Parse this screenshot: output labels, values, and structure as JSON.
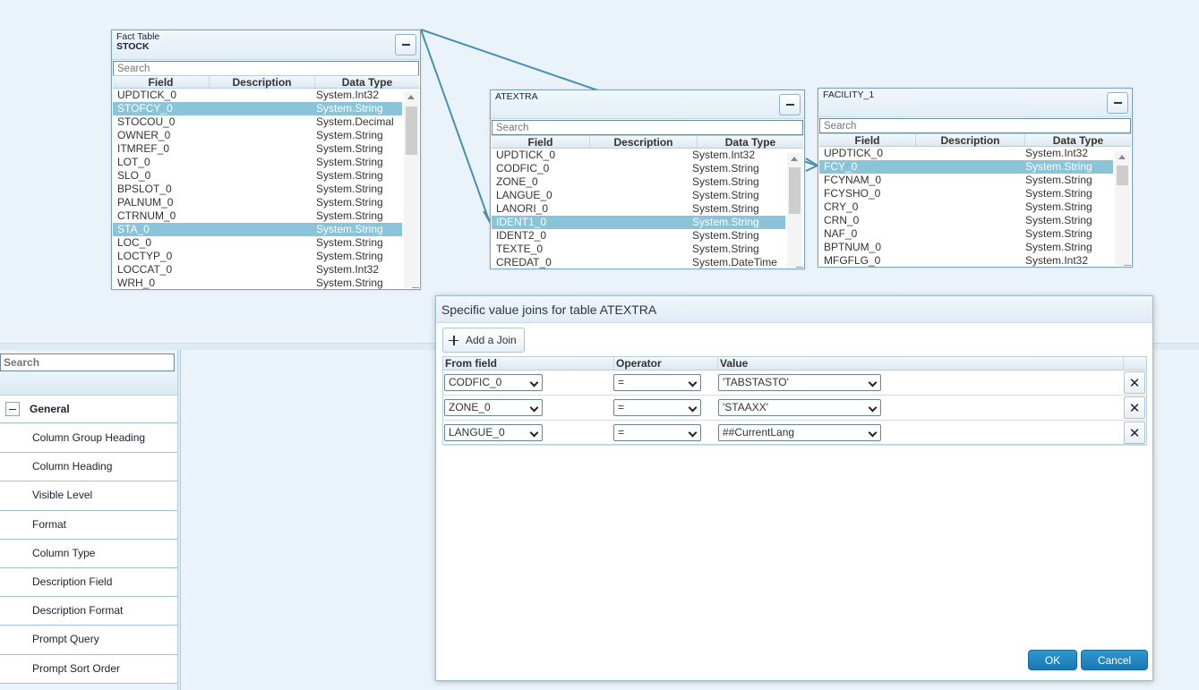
{
  "canvas": {
    "tables": [
      {
        "id": "stock",
        "title": "Fact Table",
        "subtitle": "STOCK",
        "search_placeholder": "Search",
        "columns": [
          "Field",
          "Description",
          "Data Type"
        ],
        "rows": [
          {
            "field": "UPDTICK_0",
            "description": "",
            "type": "System.Int32",
            "selected": false
          },
          {
            "field": "STOFCY_0",
            "description": "",
            "type": "System.String",
            "selected": true
          },
          {
            "field": "STOCOU_0",
            "description": "",
            "type": "System.Decimal",
            "selected": false
          },
          {
            "field": "OWNER_0",
            "description": "",
            "type": "System.String",
            "selected": false
          },
          {
            "field": "ITMREF_0",
            "description": "",
            "type": "System.String",
            "selected": false
          },
          {
            "field": "LOT_0",
            "description": "",
            "type": "System.String",
            "selected": false
          },
          {
            "field": "SLO_0",
            "description": "",
            "type": "System.String",
            "selected": false
          },
          {
            "field": "BPSLOT_0",
            "description": "",
            "type": "System.String",
            "selected": false
          },
          {
            "field": "PALNUM_0",
            "description": "",
            "type": "System.String",
            "selected": false
          },
          {
            "field": "CTRNUM_0",
            "description": "",
            "type": "System.String",
            "selected": false
          },
          {
            "field": "STA_0",
            "description": "",
            "type": "System.String",
            "selected": true
          },
          {
            "field": "LOC_0",
            "description": "",
            "type": "System.String",
            "selected": false
          },
          {
            "field": "LOCTYP_0",
            "description": "",
            "type": "System.String",
            "selected": false
          },
          {
            "field": "LOCCAT_0",
            "description": "",
            "type": "System.Int32",
            "selected": false
          },
          {
            "field": "WRH_0",
            "description": "",
            "type": "System.String",
            "selected": false
          }
        ]
      },
      {
        "id": "atextra",
        "title": "ATEXTRA",
        "subtitle": "",
        "search_placeholder": "Search",
        "columns": [
          "Field",
          "Description",
          "Data Type"
        ],
        "rows": [
          {
            "field": "UPDTICK_0",
            "description": "",
            "type": "System.Int32",
            "selected": false
          },
          {
            "field": "CODFIC_0",
            "description": "",
            "type": "System.String",
            "selected": false
          },
          {
            "field": "ZONE_0",
            "description": "",
            "type": "System.String",
            "selected": false
          },
          {
            "field": "LANGUE_0",
            "description": "",
            "type": "System.String",
            "selected": false
          },
          {
            "field": "LANORI_0",
            "description": "",
            "type": "System.String",
            "selected": false
          },
          {
            "field": "IDENT1_0",
            "description": "",
            "type": "System.String",
            "selected": true
          },
          {
            "field": "IDENT2_0",
            "description": "",
            "type": "System.String",
            "selected": false
          },
          {
            "field": "TEXTE_0",
            "description": "",
            "type": "System.String",
            "selected": false
          },
          {
            "field": "CREDAT_0",
            "description": "",
            "type": "System.DateTime",
            "selected": false
          }
        ]
      },
      {
        "id": "facility",
        "title": "FACILITY_1",
        "subtitle": "",
        "search_placeholder": "Search",
        "columns": [
          "Field",
          "Description",
          "Data Type"
        ],
        "rows": [
          {
            "field": "UPDTICK_0",
            "description": "",
            "type": "System.Int32",
            "selected": false
          },
          {
            "field": "FCY_0",
            "description": "",
            "type": "System.String",
            "selected": true
          },
          {
            "field": "FCYNAM_0",
            "description": "",
            "type": "System.String",
            "selected": false
          },
          {
            "field": "FCYSHO_0",
            "description": "",
            "type": "System.String",
            "selected": false
          },
          {
            "field": "CRY_0",
            "description": "",
            "type": "System.String",
            "selected": false
          },
          {
            "field": "CRN_0",
            "description": "",
            "type": "System.String",
            "selected": false
          },
          {
            "field": "NAF_0",
            "description": "",
            "type": "System.String",
            "selected": false
          },
          {
            "field": "BPTNUM_0",
            "description": "",
            "type": "System.String",
            "selected": false
          },
          {
            "field": "MFGFLG_0",
            "description": "",
            "type": "System.Int32",
            "selected": false
          }
        ]
      }
    ]
  },
  "properties_panel": {
    "search_placeholder": "Search",
    "group_label": "General",
    "items": [
      "Column Group Heading",
      "Column Heading",
      "Visible Level",
      "Format",
      "Column Type",
      "Description Field",
      "Description Format",
      "Prompt Query",
      "Prompt Sort Order"
    ]
  },
  "join_dialog": {
    "title": "Specific value joins for table ATEXTRA",
    "add_button_label": "Add a Join",
    "columns": [
      "From field",
      "Operator",
      "Value"
    ],
    "rows": [
      {
        "from_field": "CODFIC_0",
        "operator": "=",
        "value": "'TABSTASTO'"
      },
      {
        "from_field": "ZONE_0",
        "operator": "=",
        "value": "'STAAXX'"
      },
      {
        "from_field": "LANGUE_0",
        "operator": "=",
        "value": "##CurrentLang"
      }
    ],
    "remove_glyph": "✕",
    "ok_label": "OK",
    "cancel_label": "Cancel"
  },
  "colors": {
    "selected_row": "#8ac4d9",
    "link_line": "#4a90b3",
    "primary_button": "#1f80bb"
  }
}
